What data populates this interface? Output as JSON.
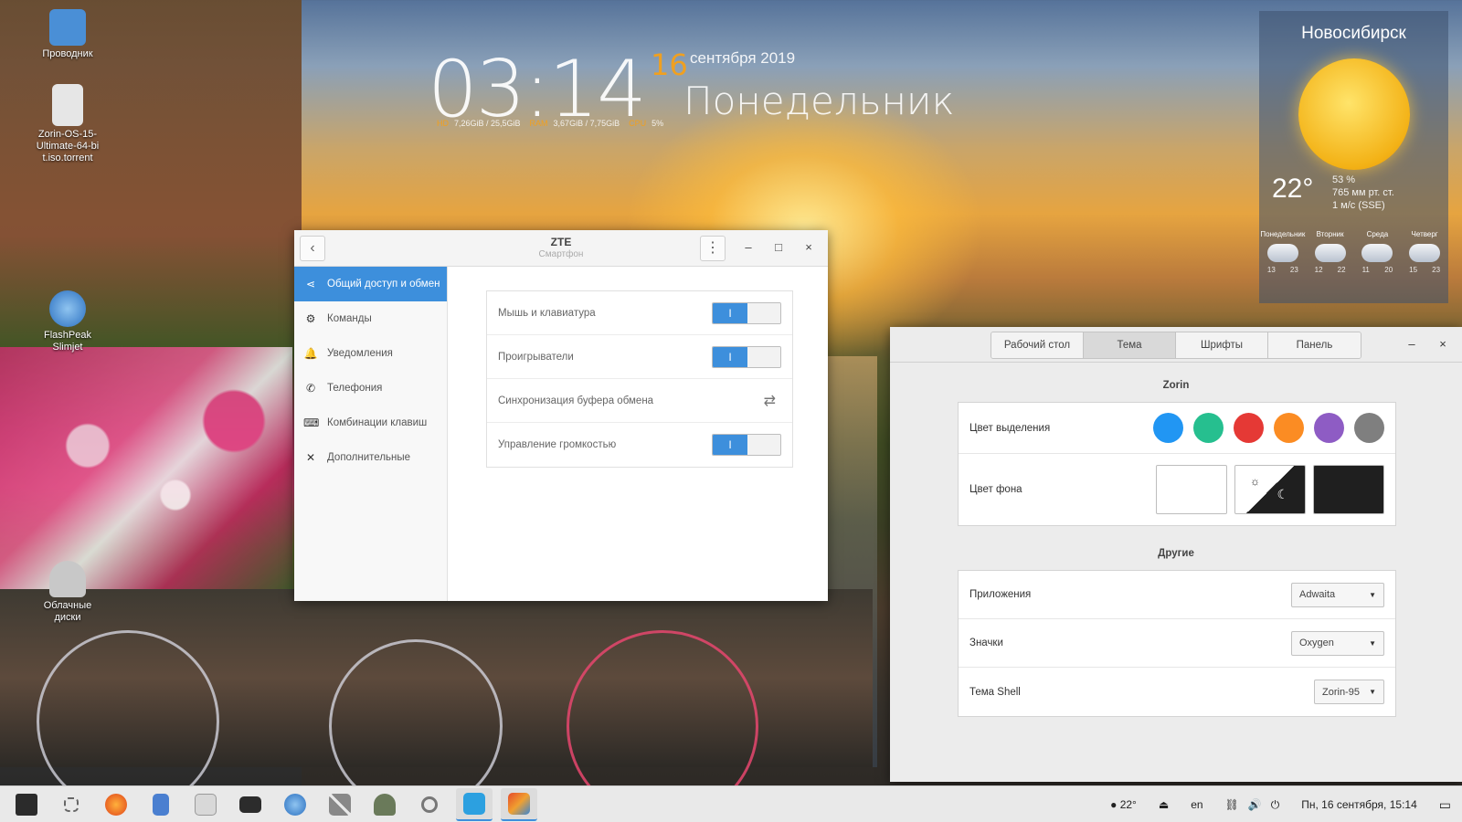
{
  "desktop": {
    "icons": [
      {
        "label": "Проводник",
        "color": "#4a8fd6"
      },
      {
        "label": "Zorin-OS-15-Ultimate-64-bit.iso.torrent",
        "color": "#e6e6e6"
      },
      {
        "label": "FlashPeak Slimjet",
        "color": "#3d7fd0"
      },
      {
        "label": "Облачные диски",
        "color": "#c8c8c8"
      }
    ]
  },
  "clock": {
    "time": "03:14",
    "day": "16",
    "month_year": "сентября 2019",
    "weekday": "Понедельник",
    "hd_label": "HD",
    "hd_value": "7,26GiB / 25,5GiB",
    "ram_label": "RAM",
    "ram_value": "3,67GiB / 7,75GiB",
    "cpu_label": "CPU",
    "cpu_value": "5%"
  },
  "weather": {
    "city": "Новосибирск",
    "temp": "22°",
    "humidity": "53 %",
    "pressure": "765 мм рт. ст.",
    "wind": "1 м/с (SSE)",
    "forecast": [
      {
        "day": "Понедельник",
        "hi": "13",
        "lo": "23"
      },
      {
        "day": "Вторник",
        "hi": "12",
        "lo": "22"
      },
      {
        "day": "Среда",
        "hi": "11",
        "lo": "20"
      },
      {
        "day": "Четверг",
        "hi": "15",
        "lo": "23"
      }
    ]
  },
  "kde": {
    "title": "ZTE",
    "subtitle": "Смартфон",
    "back_icon": "‹",
    "menu_icon": "⋮",
    "minimize": "–",
    "maximize": "□",
    "close": "×",
    "sidebar": [
      {
        "label": "Общий доступ и обмен",
        "icon": "share-icon",
        "glyph": "⋖"
      },
      {
        "label": "Команды",
        "icon": "command-icon",
        "glyph": "⚙"
      },
      {
        "label": "Уведомления",
        "icon": "bell-icon",
        "glyph": "🔔"
      },
      {
        "label": "Телефония",
        "icon": "phone-icon",
        "glyph": "✆"
      },
      {
        "label": "Комбинации клавиш",
        "icon": "keyboard-icon",
        "glyph": "⌨"
      },
      {
        "label": "Дополнительные",
        "icon": "tools-icon",
        "glyph": "✕"
      }
    ],
    "options": [
      {
        "label": "Мышь и клавиатура",
        "control": "toggle",
        "on_glyph": "I"
      },
      {
        "label": "Проигрыватели",
        "control": "toggle",
        "on_glyph": "I"
      },
      {
        "label": "Синхронизация буфера обмена",
        "control": "sync",
        "glyph": "⇄"
      },
      {
        "label": "Управление громкостью",
        "control": "toggle",
        "on_glyph": "I"
      }
    ]
  },
  "zorin": {
    "tabs": [
      "Рабочий стол",
      "Тема",
      "Шрифты",
      "Панель"
    ],
    "active_tab": "Тема",
    "minimize": "–",
    "close": "×",
    "section_zorin": "Zorin",
    "accent_label": "Цвет выделения",
    "accent_colors": [
      "#2196f3",
      "#26bf8f",
      "#e53935",
      "#fb8c23",
      "#8e5cc4",
      "#7f7f7f"
    ],
    "bg_label": "Цвет фона",
    "bg_sun": "☼",
    "bg_moon": "☾",
    "section_other": "Другие",
    "rows": [
      {
        "label": "Приложения",
        "value": "Adwaita"
      },
      {
        "label": "Значки",
        "value": "Oxygen"
      },
      {
        "label": "Тема Shell",
        "value": "Zorin-95"
      }
    ],
    "caret": "▼"
  },
  "taskbar": {
    "apps": [
      {
        "name": "zorin-menu-icon",
        "color": "#2b2b2b"
      },
      {
        "name": "workspaces-icon",
        "color": "#9a9a9a"
      },
      {
        "name": "firefox-icon",
        "color": "#f0752a"
      },
      {
        "name": "files-icon",
        "color": "#4a7fd0"
      },
      {
        "name": "store-icon",
        "color": "#d8d8d8"
      },
      {
        "name": "terminal-icon",
        "color": "#2c2c2c"
      },
      {
        "name": "browser-icon",
        "color": "#3a86d4"
      },
      {
        "name": "settings-icon",
        "color": "#8a8a8a"
      },
      {
        "name": "cat-icon",
        "color": "#6a7a5a"
      },
      {
        "name": "search-icon",
        "color": "#a8a8a8"
      },
      {
        "name": "kdeconnect-icon",
        "color": "#2ca0e0"
      },
      {
        "name": "appearance-icon",
        "color": "#e57a2a"
      }
    ],
    "weather": "22°",
    "eject": "⏏",
    "lang": "en",
    "network": "⛓",
    "volume": "🔊",
    "power": "⏻",
    "datetime": "Пн, 16 сентября, 15:14",
    "desktop_btn": "▭"
  }
}
